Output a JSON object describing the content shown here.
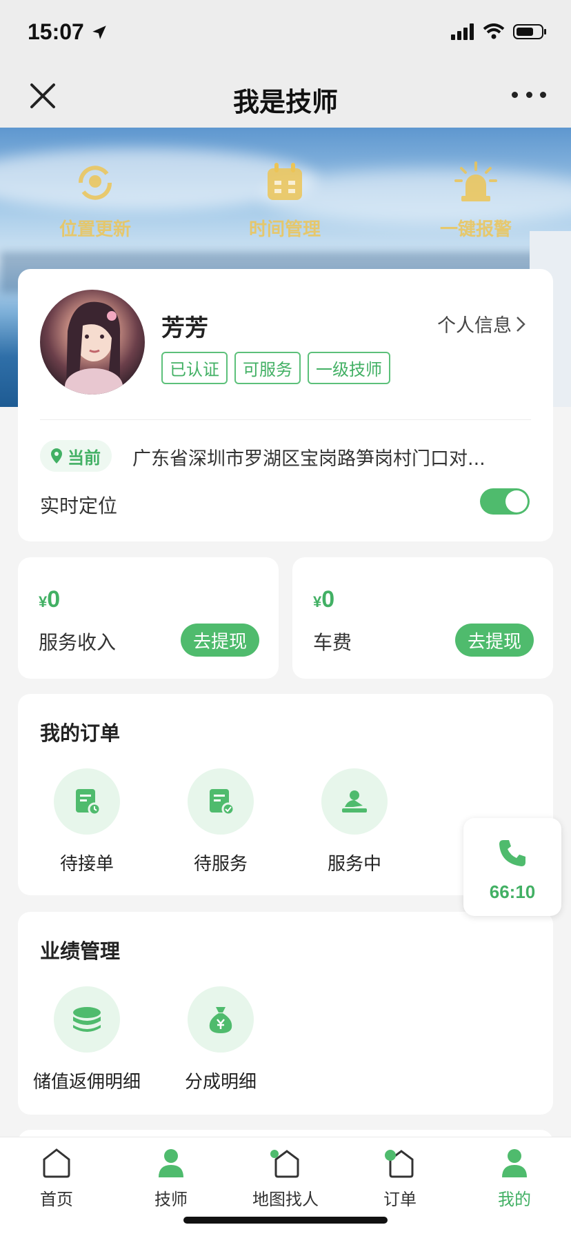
{
  "status": {
    "time": "15:07"
  },
  "nav": {
    "title": "我是技师"
  },
  "quick_actions": [
    {
      "label": "位置更新",
      "icon": "location-refresh-icon"
    },
    {
      "label": "时间管理",
      "icon": "calendar-icon"
    },
    {
      "label": "一键报警",
      "icon": "alarm-light-icon"
    }
  ],
  "profile": {
    "name": "芳芳",
    "info_link": "个人信息",
    "tags": [
      "已认证",
      "可服务",
      "一级技师"
    ],
    "location_chip": "当前",
    "address": "广东省深圳市罗湖区宝岗路笋岗村门口对...",
    "realtime_label": "实时定位",
    "realtime_on": true
  },
  "earnings": [
    {
      "currency": "¥",
      "amount": "0",
      "label": "服务收入",
      "button": "去提现"
    },
    {
      "currency": "¥",
      "amount": "0",
      "label": "车费",
      "button": "去提现"
    }
  ],
  "orders": {
    "title": "我的订单",
    "items": [
      {
        "label": "待接单",
        "icon": "order-pending-icon"
      },
      {
        "label": "待服务",
        "icon": "order-waiting-icon"
      },
      {
        "label": "服务中",
        "icon": "in-service-icon"
      }
    ]
  },
  "performance": {
    "title": "业绩管理",
    "items": [
      {
        "label": "储值返佣明细",
        "icon": "coins-icon"
      },
      {
        "label": "分成明细",
        "icon": "money-bag-icon"
      }
    ]
  },
  "call_float": {
    "timer": "66:10",
    "icon": "phone-icon"
  },
  "tabbar": {
    "items": [
      {
        "label": "首页",
        "icon": "home-icon",
        "active": false
      },
      {
        "label": "技师",
        "icon": "person-icon",
        "active": false
      },
      {
        "label": "地图找人",
        "icon": "map-icon",
        "active": false
      },
      {
        "label": "订单",
        "icon": "order-icon",
        "active": false
      },
      {
        "label": "我的",
        "icon": "user-icon",
        "active": true
      }
    ]
  },
  "colors": {
    "accent": "#4fbb6d",
    "accent_text": "#42b064",
    "banner_icon": "#ecc456",
    "background": "#f4f4f4"
  }
}
